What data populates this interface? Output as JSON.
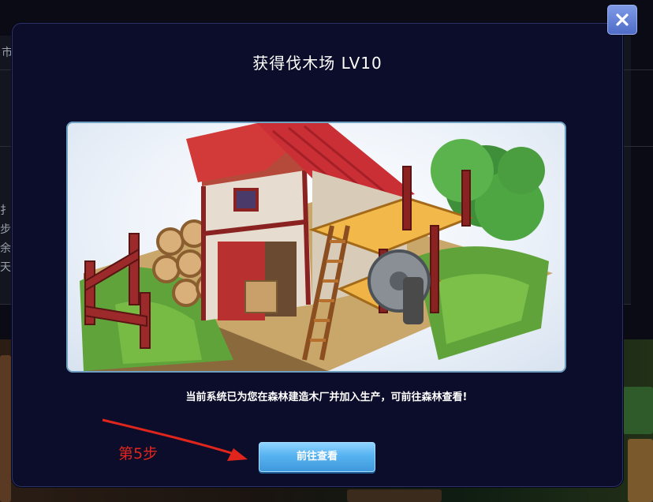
{
  "background": {
    "side_chars": [
      "市",
      "扌",
      "步，",
      "余力",
      "天"
    ]
  },
  "dialog": {
    "title": "获得伐木场 LV10",
    "image_alt": "伐木场",
    "message": "当前系统已为您在森林建造木厂并加入生产，可前往森林查看!",
    "button_label": "前往查看",
    "close_icon": "close-icon"
  },
  "annotation": {
    "step_label": "第5步",
    "color": "#e0261c"
  },
  "colors": {
    "dialog_bg": "#0b0d2b",
    "button": "#57b3f0",
    "close_button": "#5b78d4"
  }
}
